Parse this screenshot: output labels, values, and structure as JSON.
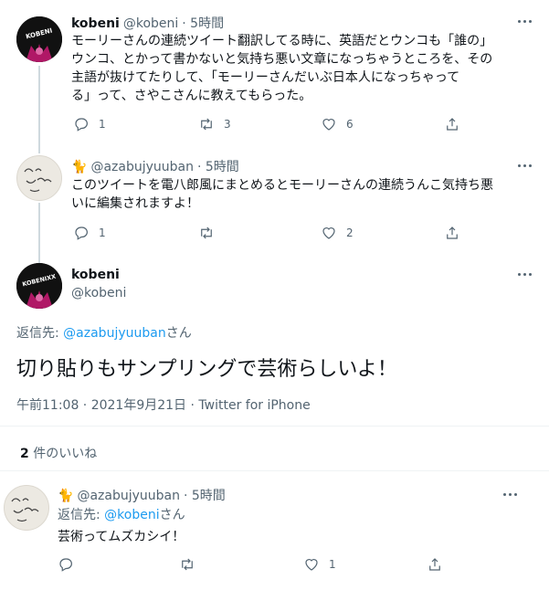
{
  "tweet1": {
    "name": "kobeni",
    "handle": "@kobeni",
    "time": "· 5時間",
    "lines": [
      "モーリーさんの連続ツイート翻訳してる時に、英語だとウンコも「誰の」",
      "ウンコ、とかって書かないと気持ち悪い文章になっちゃうところを、その",
      "主語が抜けてたりして、「モーリーさんだいぶ日本人になっちゃって",
      "る」って、さやこさんに教えてもらった。"
    ],
    "reply_count": "1",
    "retweet_count": "3",
    "like_count": "6",
    "avatar_text": "KOBENI"
  },
  "tweet2": {
    "emoji": "🐈",
    "handle": "@azabujyuuban",
    "time": "· 5時間",
    "lines": [
      "このツイートを電八郎風にまとめるとモーリーさんの連続うんこ気持ち悪",
      "いに編集されますよ！"
    ],
    "reply_count": "1",
    "like_count": "2"
  },
  "main": {
    "name": "kobeni",
    "handle": "@kobeni",
    "avatar_text": "KOBENIXX",
    "reply_to_label": "返信先: ",
    "reply_to_user": "@azabujyuuban",
    "reply_to_suffix": "さん",
    "text": "切り貼りもサンプリングで芸術らしいよ！",
    "meta": "午前11:08 · 2021年9月21日 · Twitter for iPhone",
    "likes_count": "2",
    "likes_label": " 件のいいね"
  },
  "reply": {
    "emoji": "🐈",
    "handle": "@azabujyuuban",
    "time": "· 5時間",
    "reply_to_label": "返信先: ",
    "reply_to_user": "@kobeni",
    "reply_to_suffix": "さん",
    "text": "芸術ってムズカシイ！",
    "like_count": "1"
  }
}
